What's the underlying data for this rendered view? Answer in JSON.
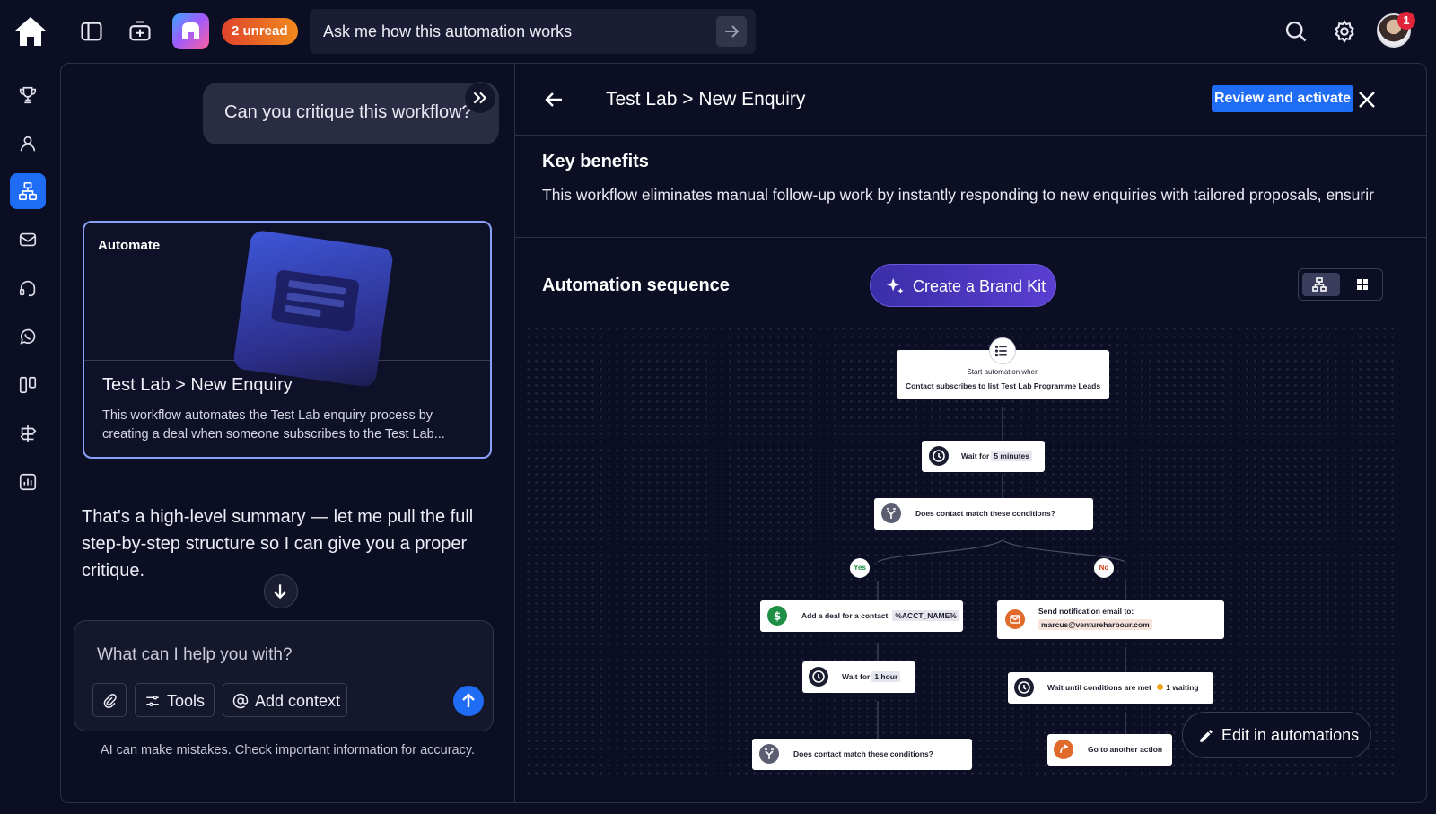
{
  "topbar": {
    "unread_badge": "2 unread",
    "ask_placeholder": "Ask me how this automation works",
    "avatar_badge": "1",
    "icons": [
      "home-icon",
      "sidebar-toggle-icon",
      "new-chat-icon",
      "app-logo",
      "search-icon",
      "gear-icon"
    ]
  },
  "nav": {
    "items": [
      {
        "name": "trophy",
        "active": false
      },
      {
        "name": "contacts",
        "active": false
      },
      {
        "name": "automations",
        "active": true
      },
      {
        "name": "email",
        "active": false
      },
      {
        "name": "conversations",
        "active": false
      },
      {
        "name": "whatsapp",
        "active": false
      },
      {
        "name": "pipeline",
        "active": false
      },
      {
        "name": "sites",
        "active": false
      },
      {
        "name": "reports",
        "active": false
      }
    ]
  },
  "chat": {
    "user_message": "Can you critique this workflow?",
    "card": {
      "tag": "Automate",
      "title": "Test Lab > New Enquiry",
      "description": "This workflow automates the Test Lab enquiry process by creating a deal when someone subscribes to the Test Lab..."
    },
    "assistant_message": "That's a high-level summary — let me pull the full step-by-step structure so I can give you a proper critique.",
    "composer": {
      "placeholder": "What can I help you with?",
      "tools_label": "Tools",
      "context_label": "Add context"
    },
    "disclaimer": "AI can make mistakes. Check important information for accuracy."
  },
  "workflow": {
    "breadcrumb": "Test Lab > New Enquiry",
    "review_button": "Review and activate",
    "key_benefits_title": "Key benefits",
    "key_benefits_text": "This workflow eliminates manual follow-up work by instantly responding to new enquiries with tailored proposals, ensurir",
    "sequence_title": "Automation sequence",
    "brand_kit_button": "Create a Brand Kit",
    "edit_button": "Edit in automations",
    "accent_color": "#1f6cf5",
    "nodes": {
      "trigger_caption": "Start automation when",
      "trigger_label": "Contact subscribes to list Test Lab Programme Leads",
      "wait1_label": "Wait for",
      "wait1_value": "5 minutes",
      "condition1_label": "Does contact match these conditions?",
      "yes_label": "Yes",
      "no_label": "No",
      "deal_label": "Add a deal for a contact",
      "deal_value": "%ACCT_NAME%",
      "notify_label": "Send notification email to:",
      "notify_value": "marcus@ventureharbour.com",
      "wait2_label": "Wait for",
      "wait2_value": "1 hour",
      "wait_until_label": "Wait until conditions are met",
      "wait_until_status": "1 waiting",
      "condition2_label": "Does contact match these conditions?",
      "goto_label": "Go to another action"
    }
  }
}
